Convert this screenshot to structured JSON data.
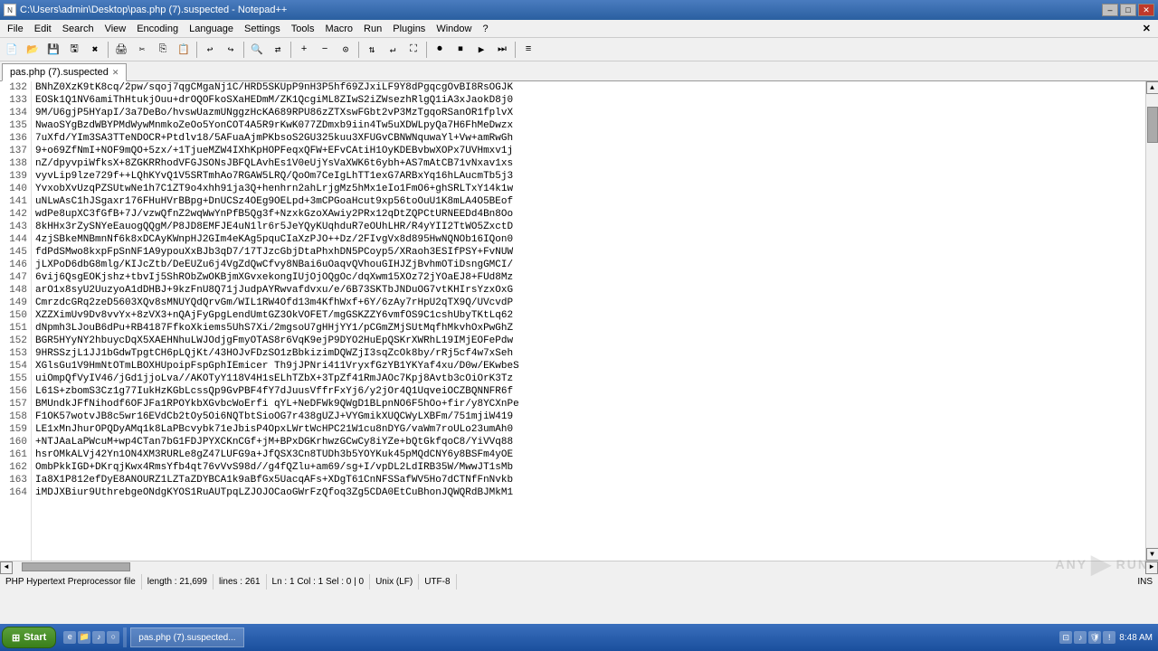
{
  "titlebar": {
    "title": "C:\\Users\\admin\\Desktop\\pas.php (7).suspected - Notepad++",
    "icon": "N",
    "minimize_label": "–",
    "maximize_label": "□",
    "close_label": "✕"
  },
  "menubar": {
    "items": [
      {
        "label": "File"
      },
      {
        "label": "Edit"
      },
      {
        "label": "Search"
      },
      {
        "label": "View"
      },
      {
        "label": "Encoding"
      },
      {
        "label": "Language"
      },
      {
        "label": "Settings"
      },
      {
        "label": "Tools"
      },
      {
        "label": "Macro"
      },
      {
        "label": "Run"
      },
      {
        "label": "Plugins"
      },
      {
        "label": "Window"
      },
      {
        "label": "?"
      }
    ]
  },
  "tab": {
    "label": "pas.php (7).suspected",
    "close": "✕"
  },
  "lines": [
    {
      "num": 132,
      "code": "BNhZ0XzK9tK8cq/2pw/sqoj7qgCMgaNj1C/HRD5SKUpP9nH3P5hf69ZJxiLF9Y8dPgqcgOvBI8RsOGJK"
    },
    {
      "num": 133,
      "code": "EOSk1Q1NV6amiThHtukjOuu+drOQOFkoSXaHEDmM/ZK1QcgiML8ZIwS2iZWsezhRlgQ1iA3xJaokD8j0"
    },
    {
      "num": 134,
      "code": "9M/U6gjP5HYapI/3a7DeBo/hvswUazmUNggzHcKA689RPU86zZTXswFGbt2vP3MzTgqoRSanOR1fplvX"
    },
    {
      "num": 135,
      "code": "NwaoSYgBzdWBYPMdWywMnmkoZeOo5YonCOT4A5R9rKwK077ZDmxb9iin4Tw5uXDWLpyQa7H6FhMeDwzx"
    },
    {
      "num": 136,
      "code": "7uXfd/YIm3SA3TTeNDOCR+Ptdlv18/5AFuaAjmPKbsoS2GU325kuu3XFUGvCBNWNquwaYl+Vw+amRwGh"
    },
    {
      "num": 137,
      "code": "9+o69ZfNmI+NOF9mQO+5zx/+1TjueMZW4IXhKpHOPFeqxQFW+EFvCAtiH1OyKDEBvbwXOPx7UVHmxv1j"
    },
    {
      "num": 138,
      "code": "nZ/dpyvpiWfksX+8ZGKRRhodVFGJSONsJBFQLAvhEs1V0eUjYsVaXWK6t6ybh+AS7mAtCB71vNxav1xs"
    },
    {
      "num": 139,
      "code": "vyvLip9lze729f++LQhKYvQ1V5SRTmhAo7RGAW5LRQ/QoOm7CeIgLhTT1exG7ARBxYq16hLAucmTb5j3"
    },
    {
      "num": 140,
      "code": "YvxobXvUzqPZSUtwNe1h7C1ZT9o4xhh91ja3Q+henhrn2ahLrjgMz5hMx1eIo1FmO6+ghSRLTxY14k1w"
    },
    {
      "num": 141,
      "code": "uNLwAsC1hJSgaxr176FHuHVrBBpg+DnUCSz4OEg9OELpd+3mCPGoaHcut9xp56toOuU1K8mLA4O5BEof"
    },
    {
      "num": 142,
      "code": "wdPe8upXC3fGfB+7J/vzwQfnZ2wqWwYnPfB5Qg3f+NzxkGzoXAwiy2PRx12qDtZQPCtURNEEDd4Bn8Oo"
    },
    {
      "num": 143,
      "code": "8kHHx3rZySNYeEauogQQgM/P8JD8EMFJE4uN1lr6r5JeYQyKUqhduR7eOUhLHR/R4yYII2TtWO5ZxctD"
    },
    {
      "num": 144,
      "code": "4zjSBkeMNBmnNf6k8xDCAyKWnpHJ2GIm4eKAg5pquCIaXzPJO++Dz/2FIvgVx8d895HwNQNOb16IQon0"
    },
    {
      "num": 145,
      "code": "fdPdSMwo8kxpFpSnNF1A9ypouXxBJb3qD7/17TJzcGbjDtaPhxhDN5PCoyp5/XRaoh3ESIfPSY+FvNUW"
    },
    {
      "num": 146,
      "code": "jLXPoD6dbG8mlg/KIJcZtb/DeEUZu6j4VgZdQwCfvy8NBai6uOaqvQVhouGIHJZjBvhmOTiDsngGMCI/"
    },
    {
      "num": 147,
      "code": "6vij6QsgEOKjshz+tbvIj5ShRObZwOKBjmXGvxekongIUjOjOQgOc/dqXwm15XOz72jYOaEJ8+FUd8Mz"
    },
    {
      "num": 148,
      "code": "arO1x8syU2UuzyoA1dDHBJ+9kzFnU8Q71jJudpAYRwvafdvxu/e/6B73SKTbJNDuOG7vtKHIrsYzxOxG"
    },
    {
      "num": 149,
      "code": "CmrzdcGRq2zeD5603XQv8sMNUYQdQrvGm/WIL1RW4Ofd13m4KfhWxf+6Y/6zAy7rHpU2qTX9Q/UVcvdP"
    },
    {
      "num": 150,
      "code": "XZZXimUv9Dv8vvYx+8zVX3+nQAjFyGpgLendUmtGZ3OkVOFET/mgGSKZZY6vmfOS9C1cshUbyTKtLq62"
    },
    {
      "num": 151,
      "code": "dNpmh3LJouB6dPu+RB4187FfkoXkiems5UhS7Xi/2mgsoU7gHHjYY1/pCGmZMjSUtMqfhMkvhOxPwGhZ"
    },
    {
      "num": 152,
      "code": "BGR5HYyNY2hbuycDqX5XAEHNhuLWJOdjgFmyOTAS8r6VqK9ejP9DYO2HuEpQSKrXWRhL19IMjEOFePdw"
    },
    {
      "num": 153,
      "code": "9HRSSzjL1JJ1bGdwTpgtCH6pLQjKt/43HOJvFDzSO1zBbkizimDQWZjI3sqZcOk8by/rRj5cf4w7xSeh"
    },
    {
      "num": 154,
      "code": "XGlsGu1V9HmNtOTmLBOXHUpoipFspGphIEmicer Th9jJPNri411VryxfGzYB1YKYaf4xu/D0w/EKwbeS"
    },
    {
      "num": 155,
      "code": "uiOmpQfVyIV46/jGd1jjoLva//AKOTyY118V4H1sELhTZbX+3TpZf41RmJAOc7Kpj8Avtb3cOiOrK3Tz"
    },
    {
      "num": 156,
      "code": "L61S+zbomS3Cz1g77IukHzKGbLcssQp9GvPBF4fY7dJuusVffrFxYj6/y2jOr4Q1UqveiOCZBQNNFR6f"
    },
    {
      "num": 157,
      "code": "BMUndkJFfNihodf6OFJFa1RPOYkbXGvbcWoErfi qYL+NeDFWk9QWgD1BLpnNO6F5hOo+fir/y8YCXnPe"
    },
    {
      "num": 158,
      "code": "F1OK57wotvJB8c5wr16EVdCb2tOy5Oi6NQTbtSioOG7r438gUZJ+VYGmikXUQCWyLXBFm/751mjiW419"
    },
    {
      "num": 159,
      "code": "LE1xMnJhurOPQDyAMq1k8LaPBcvybk71eJbisP4OpxLWrtWcHPC21W1cu8nDYG/vaWm7roULo23umAh0"
    },
    {
      "num": 160,
      "code": "+NTJAaLaPWcuM+wp4CTan7bG1FDJPYXCKnCGf+jM+BPxDGKrhwzGCwCy8iYZe+bQtGkfqoC8/YiVVq88"
    },
    {
      "num": 161,
      "code": "hsrOMkALVj42Yn1ON4XM3RURLe8gZ47LUFG9a+JfQSX3Cn8TUDh3b5YOYKuk45pMQdCNY6y8BSFm4yOE"
    },
    {
      "num": 162,
      "code": "OmbPkkIGD+DKrqjKwx4RmsYfb4qt76vVvS98d//g4fQZlu+am69/sg+I/vpDL2LdIRB35W/MwwJT1sMb"
    },
    {
      "num": 163,
      "code": "Ia8X1P812efDyE8ANOURZ1LZTaZDYBCA1k9aBfGx5UacqAFs+XDgT61CnNFSSafWV5Ho7dCTNfFnNvkb"
    },
    {
      "num": 164,
      "code": "iMDJXBiur9UthrebgeONdgKYOS1RuAUTpqLZJOJOCaoGWrFzQfoq3Zg5CDA0EtCuBhonJQWQRdBJMkM1"
    }
  ],
  "statusbar": {
    "filetype": "PHP Hypertext Preprocessor file",
    "length": "length : 21,699",
    "lines": "lines : 261",
    "position": "Ln : 1   Col : 1   Sel : 0 | 0",
    "eol": "Unix (LF)",
    "encoding": "UTF-8",
    "ins": "INS"
  },
  "taskbar": {
    "start_label": "Start",
    "app_label": "pas.php (7).suspected...",
    "time": "8:48 AM"
  },
  "watermark": {
    "text": "ANY.RUN"
  }
}
